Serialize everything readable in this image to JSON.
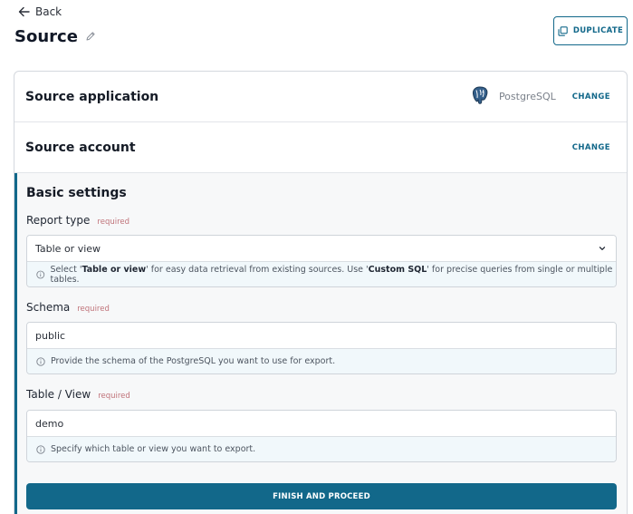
{
  "header": {
    "back_label": "Back",
    "title": "Source",
    "duplicate_label": "DUPLICATE"
  },
  "source_application": {
    "title": "Source application",
    "app_name": "PostgreSQL",
    "change_label": "CHANGE"
  },
  "source_account": {
    "title": "Source account",
    "change_label": "CHANGE"
  },
  "basic_settings": {
    "title": "Basic settings",
    "required_label": "required",
    "report_type": {
      "label": "Report type",
      "value": "Table or view",
      "hint_prefix": "Select '",
      "hint_bold_1": "Table or view",
      "hint_middle": "' for easy data retrieval from existing sources. Use '",
      "hint_bold_2": "Custom SQL",
      "hint_suffix": "' for precise queries from single or multiple tables."
    },
    "schema": {
      "label": "Schema",
      "value": "public",
      "hint": "Provide the schema of the PostgreSQL you want to use for export."
    },
    "table_view": {
      "label": "Table / View",
      "value": "demo",
      "hint": "Specify which table or view you want to export."
    },
    "submit_label": "FINISH AND PROCEED"
  },
  "colors": {
    "accent": "#12688a",
    "required": "#c0737a",
    "hint_background": "#f1f8fb",
    "section_background": "#f7f8f9"
  },
  "icons": {
    "back": "arrow-left-icon",
    "edit": "pencil-icon",
    "duplicate": "copy-icon",
    "app": "postgresql-elephant-icon",
    "dropdown": "chevron-down-icon",
    "info": "info-circle-icon"
  }
}
